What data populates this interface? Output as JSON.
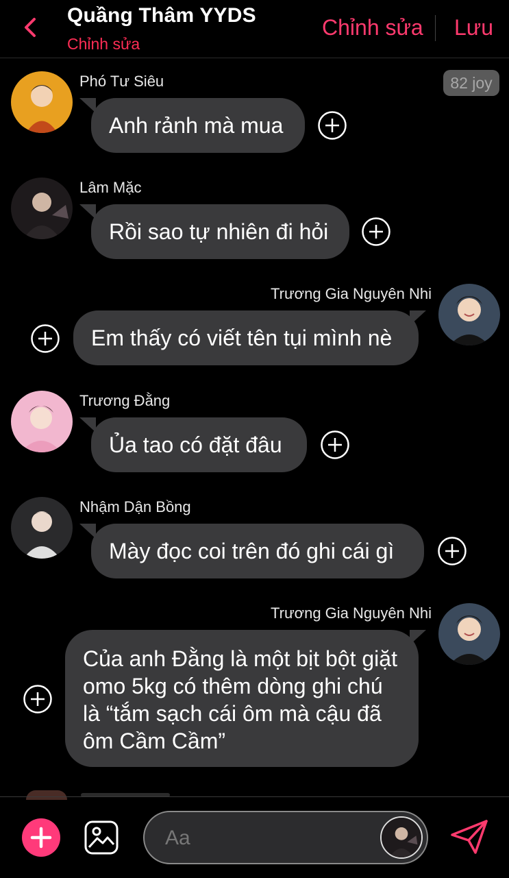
{
  "header": {
    "title": "Quầng Thâm YYDS",
    "subtitle": "Chỉnh sửa",
    "edit_label": "Chỉnh sửa",
    "save_label": "Lưu"
  },
  "badge": {
    "text": "82 joy"
  },
  "messages": [
    {
      "sender": "Phó Tư Siêu",
      "text": "Anh rảnh mà mua",
      "side": "left"
    },
    {
      "sender": "Lâm Mặc",
      "text": "Rồi sao tự nhiên đi hỏi",
      "side": "left"
    },
    {
      "sender": "Trương Gia Nguyên Nhi",
      "text": "Em thấy có viết tên tụi mình nè",
      "side": "right"
    },
    {
      "sender": "Trương Đằng",
      "text": "Ủa tao có đặt đâu",
      "side": "left"
    },
    {
      "sender": "Nhậm Dận Bồng",
      "text": "Mày đọc coi trên đó ghi cái gì",
      "side": "left"
    },
    {
      "sender": "Trương Gia Nguyên Nhi",
      "text": "Của anh Đằng là một bịt bột giặt omo 5kg có thêm dòng ghi chú là “tắm sạch cái ôm mà cậu đã ôm Cầm Cầm”",
      "side": "right"
    }
  ],
  "composer": {
    "placeholder": "Aa"
  },
  "icons": {
    "back": "chevron-left-icon",
    "add_reaction": "plus-circle-icon",
    "add": "plus-icon",
    "image": "image-icon",
    "send": "send-icon"
  },
  "colors": {
    "accent": "#ff3a6e",
    "bubble": "#3a3a3c",
    "background": "#000000",
    "badge": "#5a5a5a"
  }
}
